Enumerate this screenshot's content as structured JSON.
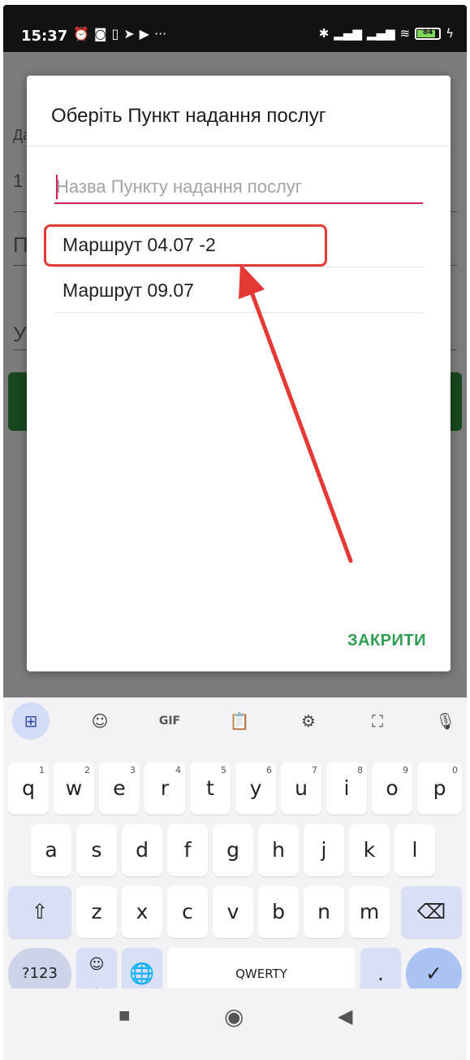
{
  "status_bar": {
    "time": "15:37",
    "left_icons": [
      "alarm-icon",
      "nfc-icon",
      "sim-icon",
      "telegram-icon",
      "youtube-icon",
      "more-icon"
    ],
    "more_text": "···",
    "right_icons": [
      "bluetooth-icon",
      "signal-icon",
      "signal-icon",
      "wifi-icon",
      "battery-icon",
      "charging-icon"
    ],
    "battery_level_percent": 84,
    "battery_text": "84"
  },
  "background_app": {
    "visible_fragments": [
      "Да",
      "1",
      "П",
      "У"
    ]
  },
  "dialog": {
    "title": "Оберіть Пункт надання послуг",
    "search_placeholder": "Назва Пункту надання послуг",
    "search_value": "",
    "items": [
      {
        "label": "Маршрут 04.07 -2",
        "highlighted": true
      },
      {
        "label": "Маршрут 09.07",
        "highlighted": false
      }
    ],
    "close_label": "ЗАКРИТИ",
    "accent_color": "#2e9e52",
    "focus_color": "#d81b60",
    "annotation_color": "#e53935"
  },
  "keyboard": {
    "toolbar": [
      "apps-grid-icon",
      "sticker-icon",
      "GIF",
      "clipboard-icon",
      "settings-icon",
      "translate-icon",
      "mic-icon"
    ],
    "gif_label": "GIF",
    "row1": [
      "q",
      "w",
      "e",
      "r",
      "t",
      "y",
      "u",
      "i",
      "o",
      "p"
    ],
    "row1_numbers": [
      "1",
      "2",
      "3",
      "4",
      "5",
      "6",
      "7",
      "8",
      "9",
      "0"
    ],
    "row2": [
      "a",
      "s",
      "d",
      "f",
      "g",
      "h",
      "j",
      "k",
      "l"
    ],
    "row3": [
      "z",
      "x",
      "c",
      "v",
      "b",
      "n",
      "m"
    ],
    "symbols_label": "?123",
    "comma_label": ",",
    "space_label": "QWERTY",
    "period_label": "."
  },
  "navigation": [
    "recents-icon",
    "home-icon",
    "back-icon"
  ]
}
